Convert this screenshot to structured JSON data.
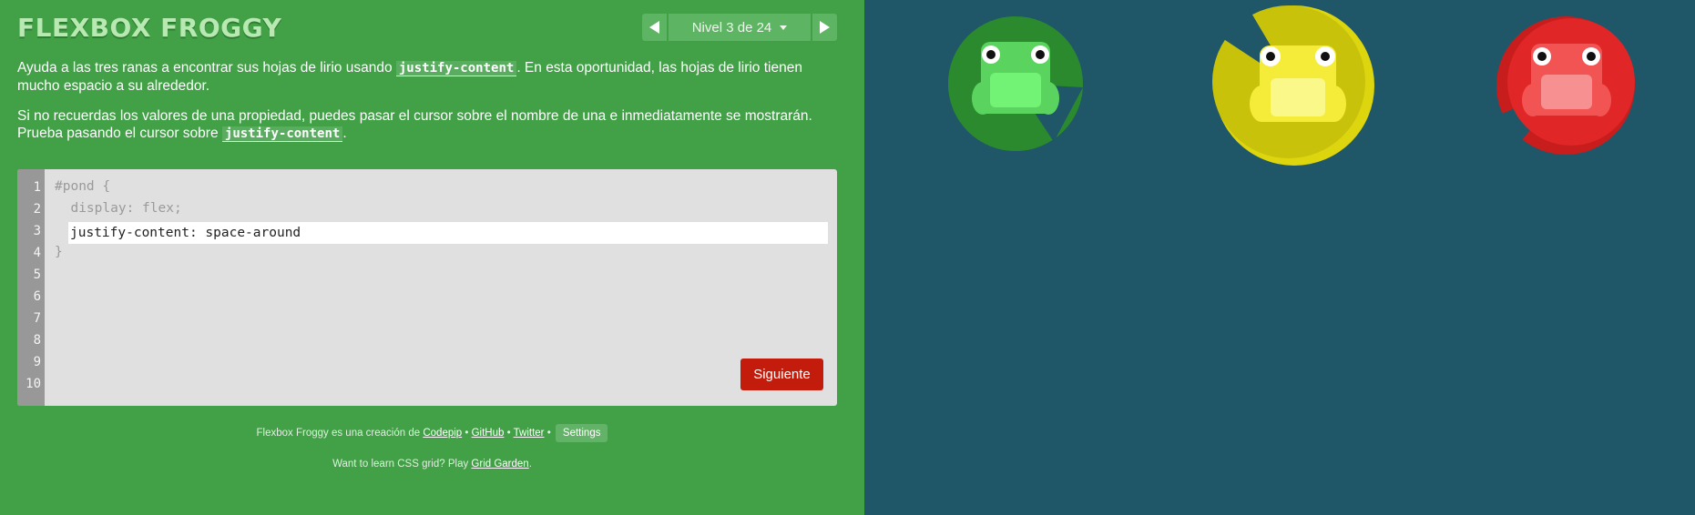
{
  "app": {
    "title": "FLEXBOX FROGGY"
  },
  "level_nav": {
    "prev_icon": "triangle-left-icon",
    "label": "Nivel 3 de 24",
    "caret_icon": "chevron-down-icon",
    "next_icon": "triangle-right-icon"
  },
  "instructions": {
    "p1_before": "Ayuda a las tres ranas a encontrar sus hojas de lirio usando ",
    "p1_code": "justify-content",
    "p1_after": ". En esta oportunidad, las hojas de lirio tienen mucho espacio a su alrededor.",
    "p2_before": "Si no recuerdas los valores de una propiedad, puedes pasar el cursor sobre el nombre de una e inmediatamente se mostrarán. Prueba pasando el cursor sobre ",
    "p2_code": "justify-content",
    "p2_after": "."
  },
  "editor": {
    "line_numbers": [
      "1",
      "2",
      "3",
      "4",
      "5",
      "6",
      "7",
      "8",
      "9",
      "10"
    ],
    "line1": "#pond {",
    "line2": "  display: flex;",
    "input_value": "justify-content: space-around",
    "line4": "}",
    "next_label": "Siguiente"
  },
  "footer": {
    "credit_prefix": "Flexbox Froggy es una creación de ",
    "codepip": "Codepip",
    "sep": " • ",
    "github": "GitHub",
    "twitter": "Twitter",
    "settings": "Settings",
    "grid_prefix": "Want to learn CSS grid? Play ",
    "grid_garden": "Grid Garden",
    "grid_suffix": "."
  },
  "pond": {
    "frogs": [
      {
        "color": "green",
        "pad": "#2b8a2e",
        "body": "#5bd35f",
        "belly": "#72f376"
      },
      {
        "color": "yellow",
        "pad": "#c9c20a",
        "body": "#f5ec3a",
        "belly": "#fbf88a"
      },
      {
        "color": "red",
        "pad": "#c71d1d",
        "body": "#f25353",
        "belly": "#f79090"
      }
    ]
  },
  "colors": {
    "sidebar_bg": "#42a047",
    "pond_bg": "#1f5768",
    "next_button": "#c41c0c"
  }
}
